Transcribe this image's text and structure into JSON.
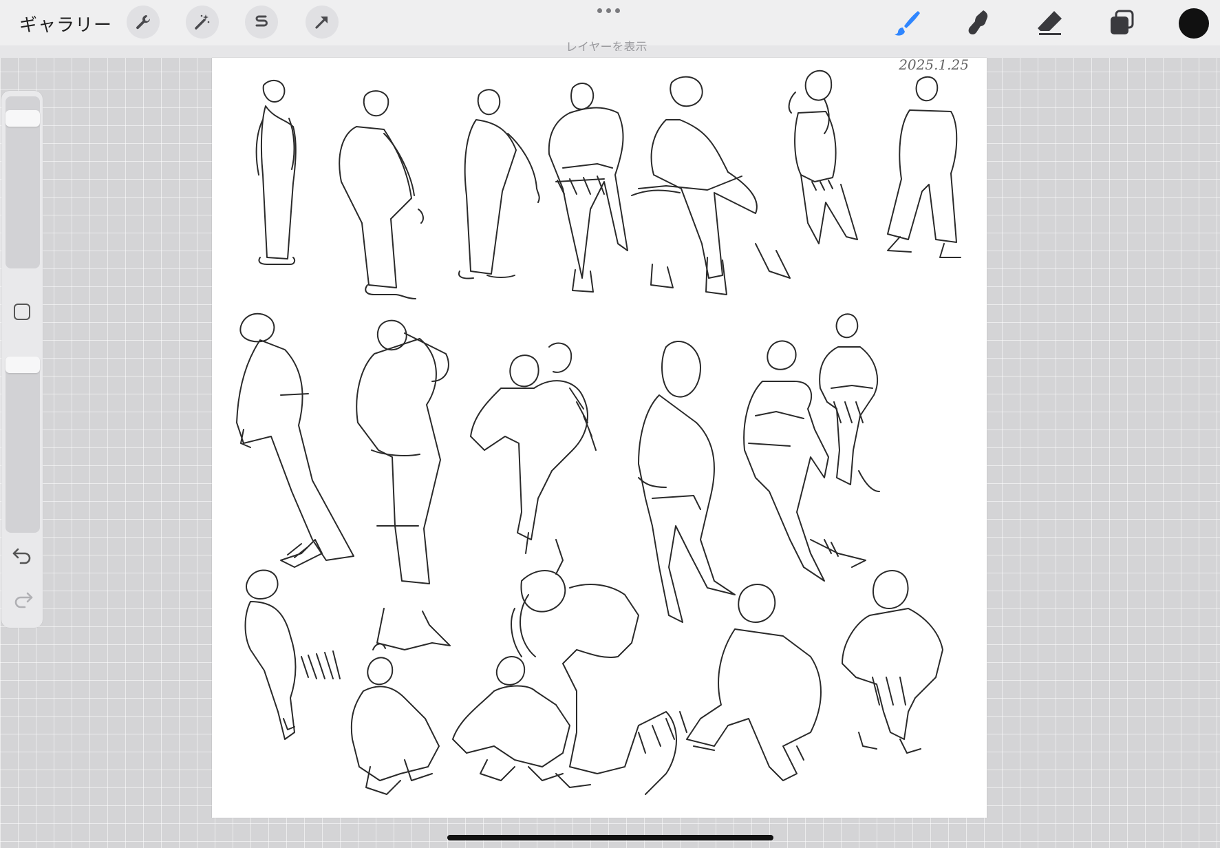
{
  "toolbar": {
    "gallery_label": "ギャラリー",
    "left_tools": [
      {
        "icon": "wrench-icon",
        "name": "actions"
      },
      {
        "icon": "magic-wand-icon",
        "name": "adjustments"
      },
      {
        "icon": "selection-s-icon",
        "name": "selection"
      },
      {
        "icon": "transform-arrow-icon",
        "name": "transform"
      }
    ],
    "right_tools": [
      {
        "icon": "brush-icon",
        "name": "paint",
        "active": true,
        "color": "#2f86ff"
      },
      {
        "icon": "smudge-icon",
        "name": "smudge"
      },
      {
        "icon": "eraser-icon",
        "name": "eraser"
      },
      {
        "icon": "layers-icon",
        "name": "layers"
      }
    ],
    "current_color": "#111111"
  },
  "layer_hint": "レイヤーを表示",
  "canvas": {
    "signature": "2025.1.25"
  },
  "sidebar": {
    "brush_size_slider": {
      "level": 0.05
    },
    "opacity_slider": {
      "level": 0.03
    },
    "modify_icon": "square-icon",
    "undo_icon": "undo-icon",
    "redo_icon": "redo-icon"
  },
  "colors": {
    "accent": "#2f86ff",
    "toolbar_bg": "#efeff0",
    "canvas_bg": "#ffffff"
  }
}
